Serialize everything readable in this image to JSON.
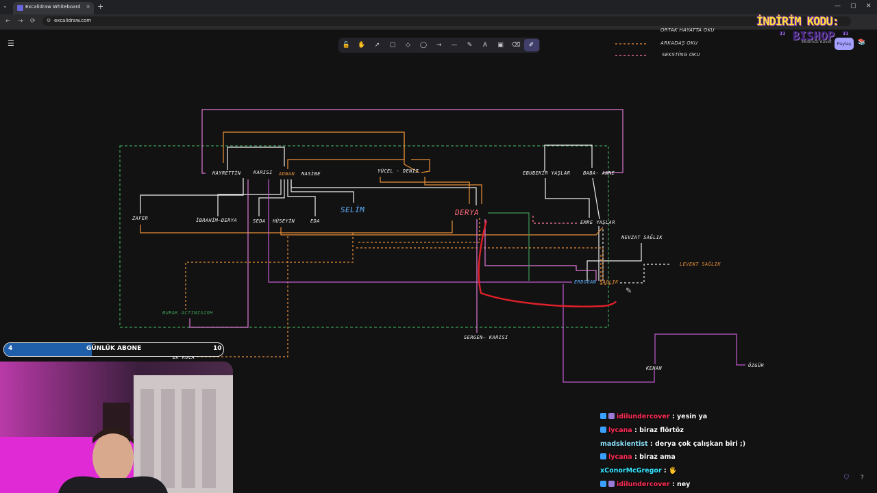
{
  "browser": {
    "tab_title": "Excalidraw Whiteboard",
    "new_tab": "+",
    "tab_close": "×",
    "url": "excalidraw.com",
    "window_controls": [
      "—",
      "▢",
      "✕"
    ]
  },
  "app": {
    "share_label": "Paylaş",
    "collab_label": "Ekibinizi davet",
    "tools": [
      {
        "name": "lock",
        "glyph": "🔓"
      },
      {
        "name": "hand",
        "glyph": "✋"
      },
      {
        "name": "selection",
        "glyph": "➚"
      },
      {
        "name": "rectangle",
        "glyph": "▢"
      },
      {
        "name": "diamond",
        "glyph": "◇"
      },
      {
        "name": "ellipse",
        "glyph": "◯"
      },
      {
        "name": "arrow",
        "glyph": "→"
      },
      {
        "name": "line",
        "glyph": "—"
      },
      {
        "name": "draw",
        "glyph": "✎"
      },
      {
        "name": "text",
        "glyph": "A"
      },
      {
        "name": "image",
        "glyph": "▣"
      },
      {
        "name": "eraser",
        "glyph": "⌫"
      },
      {
        "name": "laser",
        "glyph": "✐",
        "active": true
      }
    ]
  },
  "legend": {
    "items": [
      {
        "label": "ORTAK HAYATTA OKU",
        "color": "#ffffff"
      },
      {
        "label": "ARKADAŞ OKU",
        "color": "#e8913a"
      },
      {
        "label": "SEKSTİNG OKU",
        "color": "#ff7b9c"
      }
    ]
  },
  "diagram": {
    "nodes": {
      "hayrettin": "HAYRETTİN",
      "karisi1": "KARISI",
      "adnan": "ADNAN",
      "nasibe": "NASİBE",
      "yucel_deniz": "YÜCEL - DENİZ",
      "ebubekir": "EBUBEKİR YAŞLAR",
      "baba_anne": "BABA- ANNE",
      "zafer": "ZAFER",
      "ibrahim_derya": "İBRAHİM—DERYA",
      "seda": "SEDA",
      "huseyin": "HÜSEYİN",
      "eda": "EDA",
      "selim": "SELİM",
      "derya": "DERYA",
      "emre": "EMRE YAŞLAR",
      "nevzat": "NEVZAT SAĞLIK",
      "levent": "LEVENT SAĞLIK",
      "erdogan": "ERDOĞAN",
      "saglik": "SAĞLIK",
      "burak": "BURAK ACTINISIOH",
      "sergen": "SERGEN— KARISI",
      "ek_koca": "EK KOCA",
      "kenan": "KENAN",
      "ozgur": "ÖZGÜR"
    }
  },
  "overlay": {
    "promo_line1": "İNDİRİM KODU:",
    "promo_line2": "\" BISHOP \"",
    "subgoal": {
      "label": "GÜNLÜK ABONE",
      "current": "4",
      "target": "10",
      "progress": 0.4
    },
    "chat": [
      {
        "user": "idilundercover",
        "text": "yesin ya",
        "color": "#ff2d55",
        "badges": 2
      },
      {
        "user": "lycana",
        "text": "biraz flörtöz",
        "color": "#ff2d55",
        "badges": 1
      },
      {
        "user": "madskientist",
        "text": "derya çok çalışkan biri ;)",
        "color": "#8fe3ff",
        "badges": 0
      },
      {
        "user": "lycana",
        "text": "biraz ama",
        "color": "#ff2d55",
        "badges": 1
      },
      {
        "user": "xConorMcGregor",
        "text": "🖐",
        "color": "#35e6ff",
        "badges": 0
      },
      {
        "user": "idilundercover",
        "text": "ney",
        "color": "#ff2d55",
        "badges": 2
      }
    ]
  }
}
